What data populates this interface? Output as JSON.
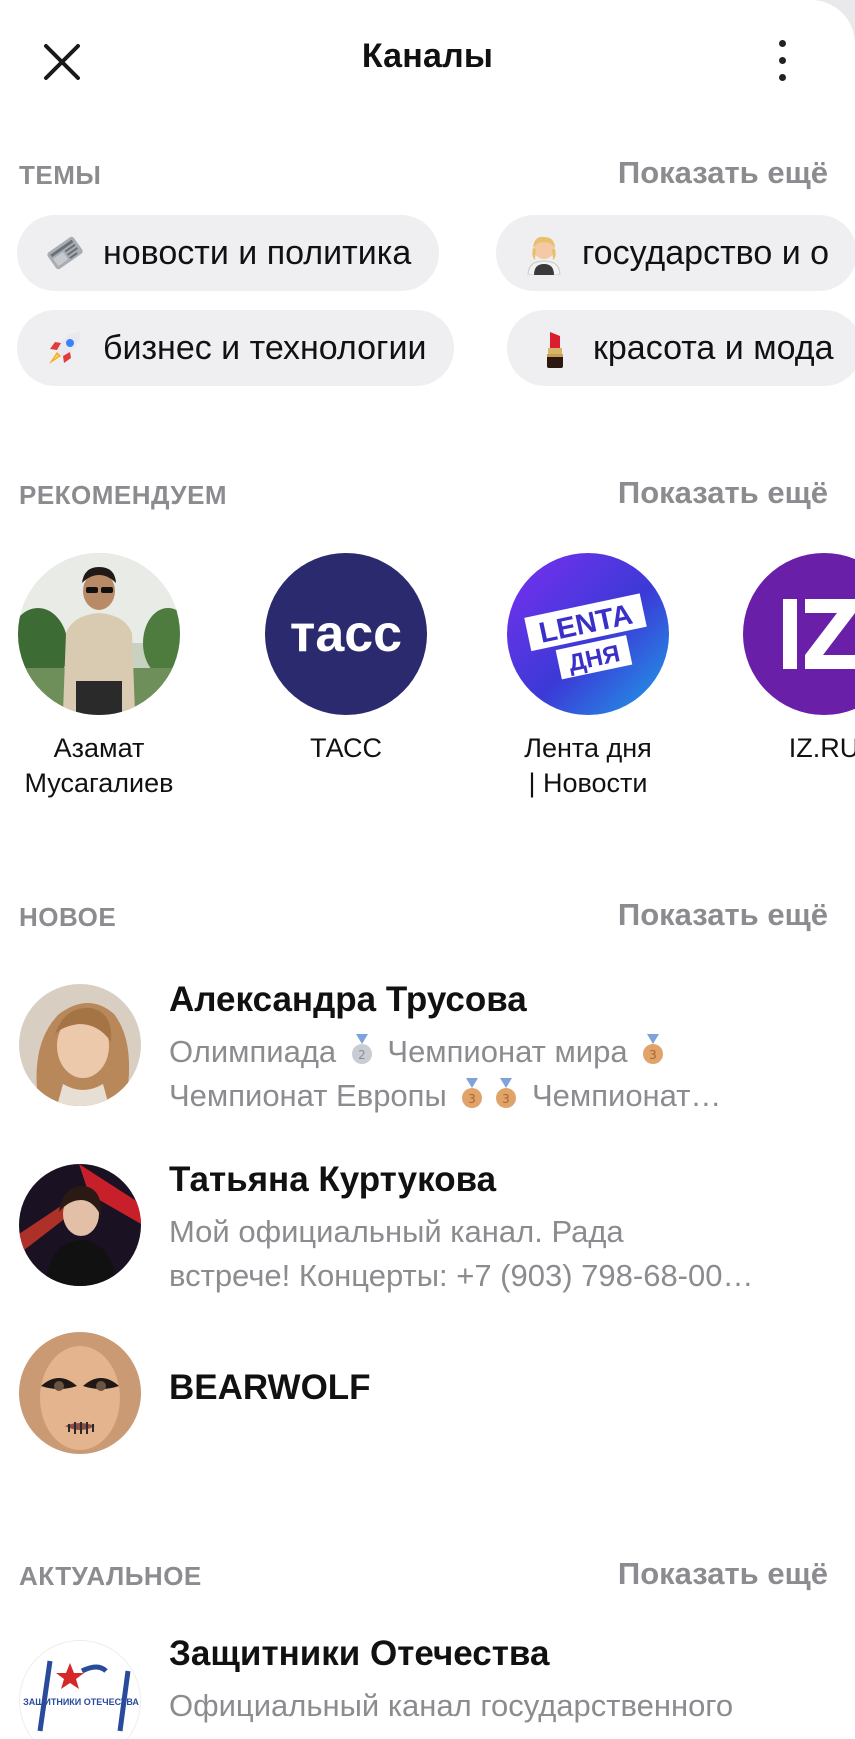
{
  "header": {
    "title": "Каналы",
    "close_icon": "close-icon",
    "menu_icon": "more-vertical-icon"
  },
  "sections": {
    "topics": {
      "title": "ТЕМЫ",
      "more": "Показать ещё"
    },
    "recommended": {
      "title": "РЕКОМЕНДУЕМ",
      "more": "Показать ещё"
    },
    "new": {
      "title": "НОВОЕ",
      "more": "Показать ещё"
    },
    "actual": {
      "title": "АКТУАЛЬНОЕ",
      "more": "Показать ещё"
    }
  },
  "topics": [
    {
      "label": "новости и политика",
      "icon": "newspaper-icon"
    },
    {
      "label": "государство и о",
      "icon": "person-icon"
    },
    {
      "label": "бизнес и технологии",
      "icon": "rocket-icon"
    },
    {
      "label": "красота и мода",
      "icon": "lipstick-icon"
    }
  ],
  "recommended": [
    {
      "name_line1": "Азамат",
      "name_line2": "Мусагалиев"
    },
    {
      "name_line1": "ТАСС",
      "name_line2": "",
      "logo_text": "тасс",
      "color": "#2b2a6e"
    },
    {
      "name_line1": "Лента дня",
      "name_line2": "| Новости",
      "logo_line1": "LENTA",
      "logo_line2": "ДНЯ",
      "color": "#5b3fd1"
    },
    {
      "name_line1": "IZ.RU",
      "name_line2": "",
      "logo_text": "iz",
      "color": "#6a1fa8"
    }
  ],
  "new_channels": [
    {
      "name": "Александра Трусова",
      "desc_line1_a": "Олимпиада",
      "desc_line1_b": "Чемпионат мира",
      "desc_line2_a": "Чемпионат Европы",
      "desc_line2_b": "Чемпионат…"
    },
    {
      "name": "Татьяна Куртукова",
      "desc_line1": "Мой официальный канал. Рада",
      "desc_line2": "встрече! Концерты: +7 (903) 798-68-00…"
    },
    {
      "name": "BEARWOLF"
    }
  ],
  "actual_channels": [
    {
      "name": "Защитники Отечества",
      "desc_line1": "Официальный канал государственного",
      "logo_text": "ЗАЩИТНИКИ ОТЕЧЕСТВА"
    }
  ],
  "colors": {
    "muted": "#8c8c90",
    "chip_bg": "#efeff1",
    "medal_silver": "#c9ccd3",
    "medal_bronze": "#e0a36a"
  }
}
